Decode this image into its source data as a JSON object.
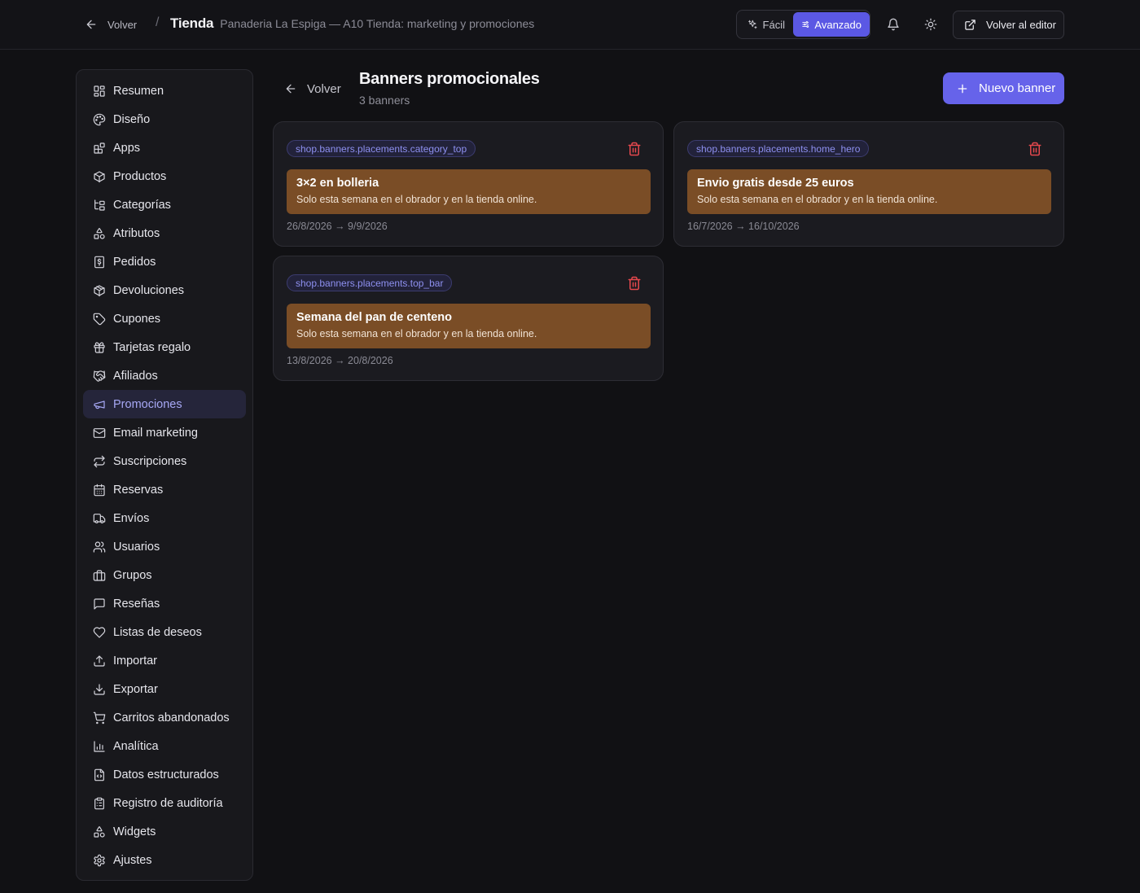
{
  "topbar": {
    "back_label": "Volver",
    "separator": "/",
    "title": "Tienda",
    "subtitle": "Panaderia La Espiga — A10 Tienda: marketing y promociones",
    "mode_easy": "Fácil",
    "mode_advanced": "Avanzado",
    "active_mode": "Avanzado",
    "editor_button": "Volver al editor"
  },
  "sidebar": {
    "active": "Promociones",
    "items": [
      {
        "label": "Resumen",
        "icon": "layout-dashboard-icon"
      },
      {
        "label": "Diseño",
        "icon": "palette-icon"
      },
      {
        "label": "Apps",
        "icon": "blocks-icon"
      },
      {
        "label": "Productos",
        "icon": "package-icon"
      },
      {
        "label": "Categorías",
        "icon": "folder-tree-icon"
      },
      {
        "label": "Atributos",
        "icon": "shapes-icon"
      },
      {
        "label": "Pedidos",
        "icon": "receipt-icon"
      },
      {
        "label": "Devoluciones",
        "icon": "package-return-icon"
      },
      {
        "label": "Cupones",
        "icon": "tag-icon"
      },
      {
        "label": "Tarjetas regalo",
        "icon": "gift-icon"
      },
      {
        "label": "Afiliados",
        "icon": "handshake-icon"
      },
      {
        "label": "Promociones",
        "icon": "megaphone-icon"
      },
      {
        "label": "Email marketing",
        "icon": "mail-icon"
      },
      {
        "label": "Suscripciones",
        "icon": "repeat-icon"
      },
      {
        "label": "Reservas",
        "icon": "calendar-icon"
      },
      {
        "label": "Envíos",
        "icon": "truck-icon"
      },
      {
        "label": "Usuarios",
        "icon": "users-icon"
      },
      {
        "label": "Grupos",
        "icon": "briefcase-icon"
      },
      {
        "label": "Reseñas",
        "icon": "message-square-icon"
      },
      {
        "label": "Listas de deseos",
        "icon": "heart-icon"
      },
      {
        "label": "Importar",
        "icon": "upload-icon"
      },
      {
        "label": "Exportar",
        "icon": "download-icon"
      },
      {
        "label": "Carritos abandonados",
        "icon": "shopping-cart-icon"
      },
      {
        "label": "Analítica",
        "icon": "bar-chart-icon"
      },
      {
        "label": "Datos estructurados",
        "icon": "file-code-icon"
      },
      {
        "label": "Registro de auditoría",
        "icon": "clipboard-list-icon"
      },
      {
        "label": "Widgets",
        "icon": "shapes-icon"
      },
      {
        "label": "Ajustes",
        "icon": "settings-icon"
      }
    ]
  },
  "main": {
    "back_label": "Volver",
    "title": "Banners promocionales",
    "subtitle": "3 banners",
    "new_button": "Nuevo banner",
    "banners": [
      {
        "placement": "shop.banners.placements.category_top",
        "title": "3×2 en bolleria",
        "text": "Solo esta semana en el obrador y en la tienda online.",
        "dates": "26/8/2026 → 9/9/2026"
      },
      {
        "placement": "shop.banners.placements.home_hero",
        "title": "Envio gratis desde 25 euros",
        "text": "Solo esta semana en el obrador y en la tienda online.",
        "dates": "16/7/2026 → 16/10/2026"
      },
      {
        "placement": "shop.banners.placements.top_bar",
        "title": "Semana del pan de centeno",
        "text": "Solo esta semana en el obrador y en la tienda online.",
        "dates": "13/8/2026 → 20/8/2026"
      }
    ]
  },
  "colors": {
    "background": "#111114",
    "accent": "#6663ea",
    "banner_fill": "#7a4d26",
    "danger": "#e5484d",
    "active_nav_text": "#a7a8f5"
  }
}
